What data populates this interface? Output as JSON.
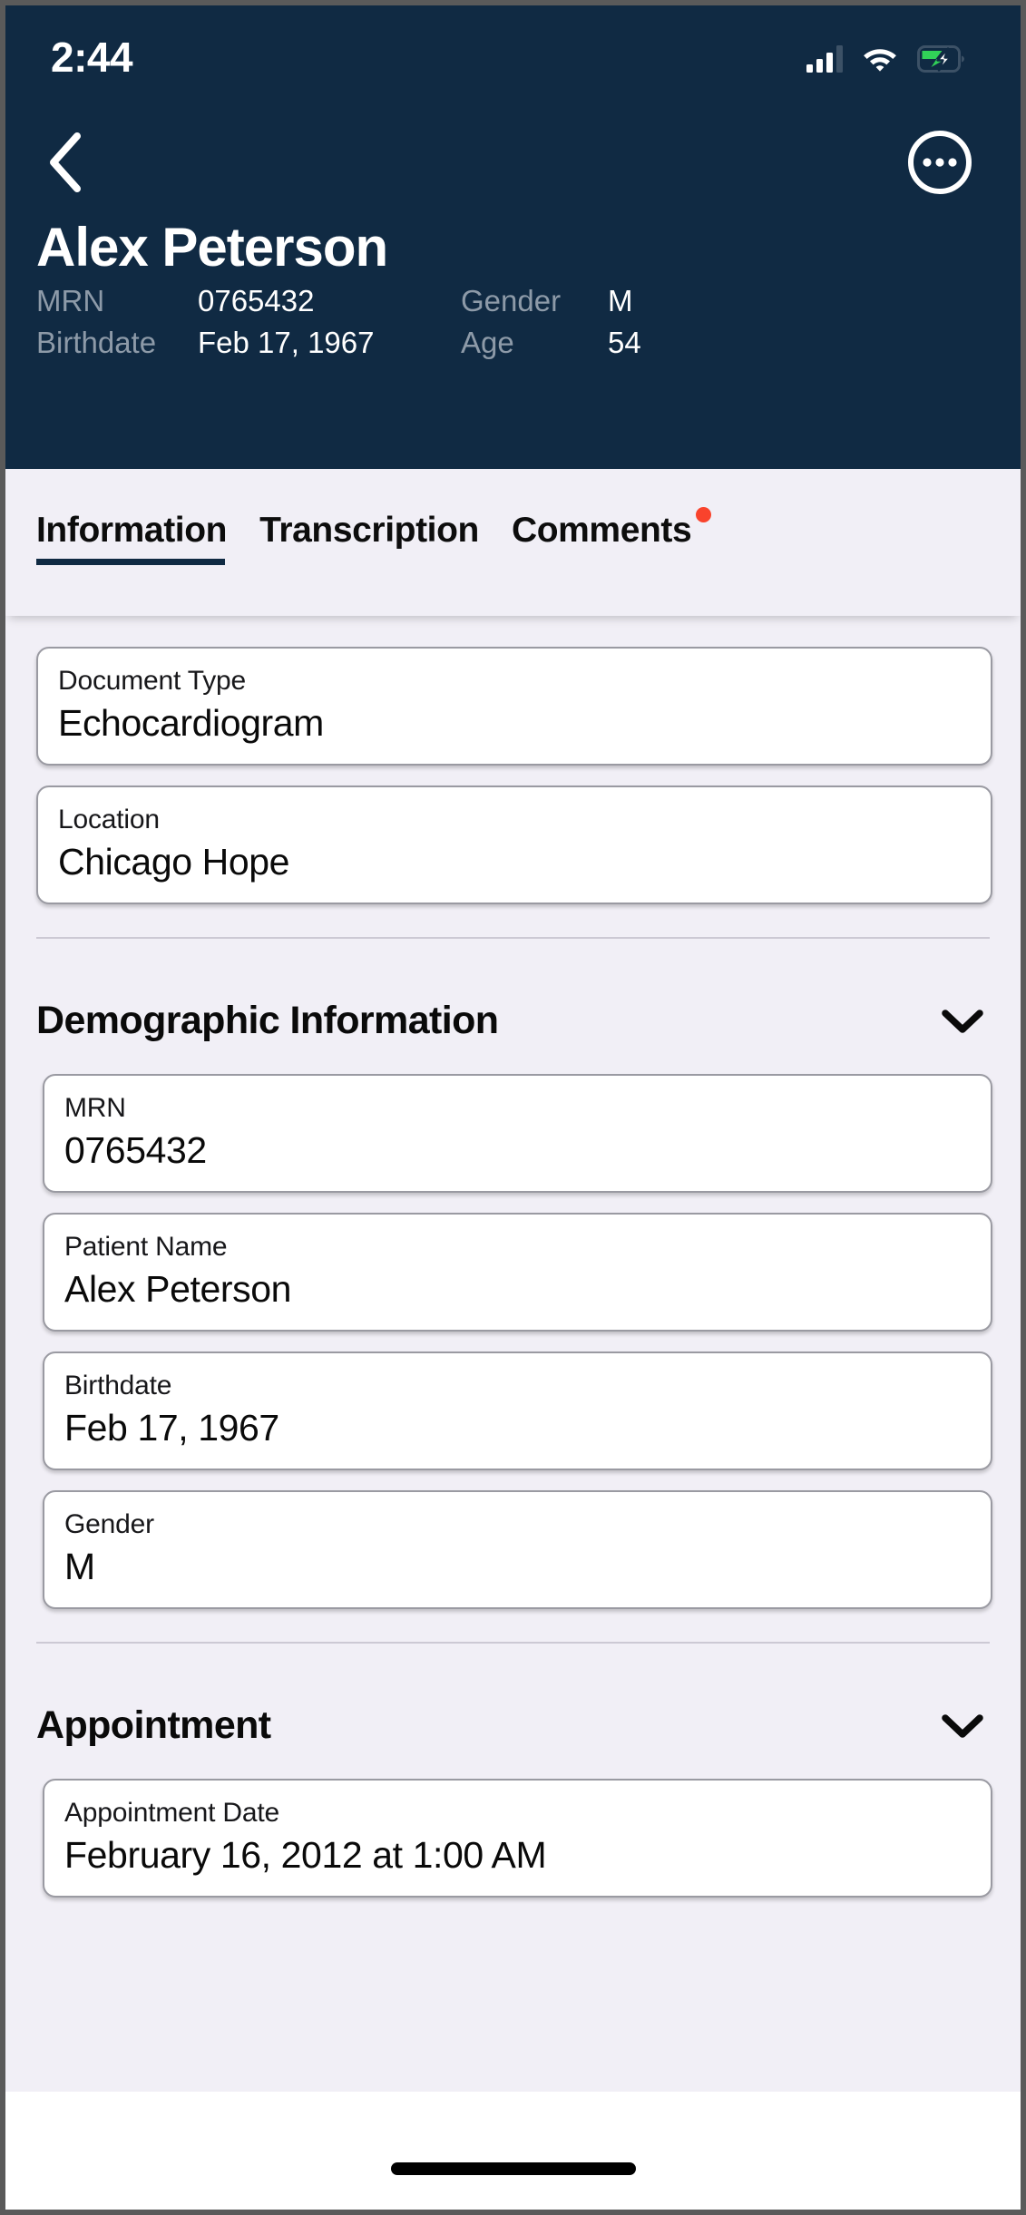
{
  "status_bar": {
    "time": "2:44",
    "icons": [
      "cellular-signal-icon",
      "wifi-icon",
      "battery-charging-icon"
    ]
  },
  "nav": {
    "back_icon": "chevron-left-icon",
    "more_icon": "more-options-icon"
  },
  "patient": {
    "name": "Alex Peterson",
    "mrn_label": "MRN",
    "mrn_value": "0765432",
    "gender_label": "Gender",
    "gender_value": "M",
    "birthdate_label": "Birthdate",
    "birthdate_value": "Feb 17, 1967",
    "age_label": "Age",
    "age_value": "54"
  },
  "tabs": [
    {
      "label": "Information",
      "active": true,
      "badge": false
    },
    {
      "label": "Transcription",
      "active": false,
      "badge": false
    },
    {
      "label": "Comments",
      "active": false,
      "badge": true
    }
  ],
  "document_fields": [
    {
      "label": "Document Type",
      "value": "Echocardiogram"
    },
    {
      "label": "Location",
      "value": "Chicago Hope"
    }
  ],
  "demographic_section": {
    "title": "Demographic Information",
    "chevron_icon": "chevron-down-icon",
    "fields": [
      {
        "label": "MRN",
        "value": "0765432"
      },
      {
        "label": "Patient Name",
        "value": "Alex Peterson"
      },
      {
        "label": "Birthdate",
        "value": "Feb 17, 1967"
      },
      {
        "label": "Gender",
        "value": "M"
      }
    ]
  },
  "appointment_section": {
    "title": "Appointment",
    "chevron_icon": "chevron-down-icon",
    "fields": [
      {
        "label": "Appointment Date",
        "value": "February 16, 2012 at 1:00 AM"
      }
    ]
  },
  "colors": {
    "header_bg": "#102a43",
    "page_bg": "#f1eff6",
    "badge_red": "#f9432c",
    "battery_green": "#31d158",
    "card_border": "#9a9aa2"
  }
}
